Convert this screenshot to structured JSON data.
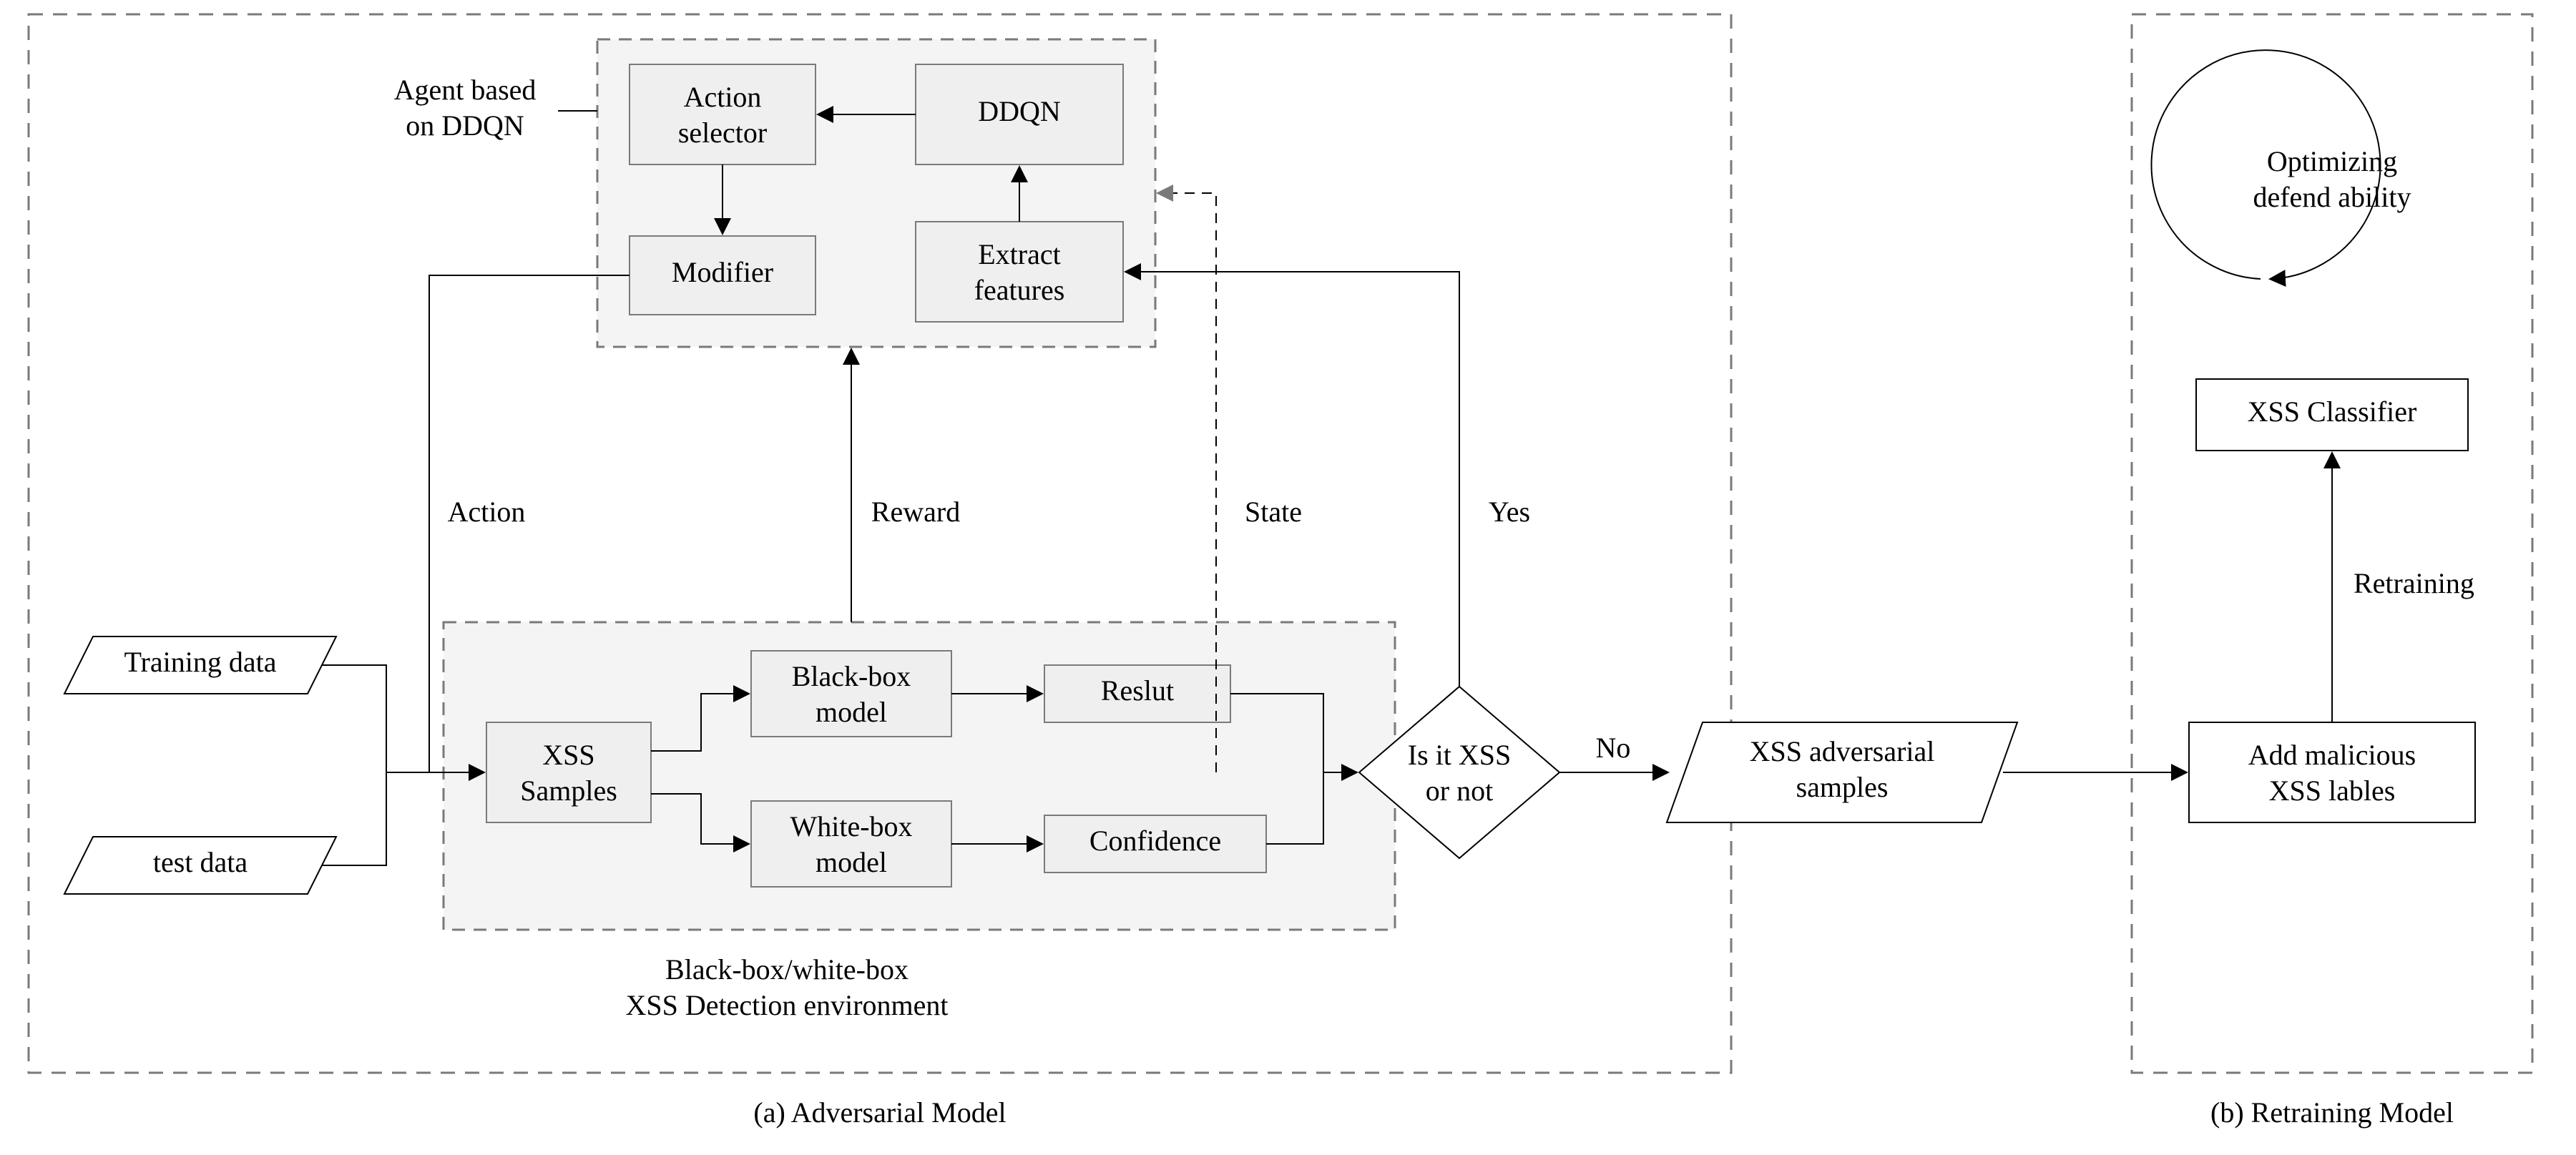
{
  "panel_a": {
    "caption": "(a) Adversarial Model",
    "agent": {
      "label_l1": "Agent based",
      "label_l2": "on DDQN",
      "action_selector_l1": "Action",
      "action_selector_l2": "selector",
      "ddqn": "DDQN",
      "modifier": "Modifier",
      "extract_l1": "Extract",
      "extract_l2": "features"
    },
    "env": {
      "label_l1": "Black-box/white-box",
      "label_l2": "XSS Detection environment",
      "xss_samples_l1": "XSS",
      "xss_samples_l2": "Samples",
      "black_l1": "Black-box",
      "black_l2": "model",
      "white_l1": "White-box",
      "white_l2": "model",
      "result": "Reslut",
      "confidence": "Confidence"
    },
    "inputs": {
      "training": "Training data",
      "test": "test data"
    },
    "edges": {
      "action": "Action",
      "reward": "Reward",
      "state": "State",
      "yes": "Yes",
      "no": "No"
    },
    "decision_l1": "Is it XSS",
    "decision_l2": "or not",
    "adv_samples_l1": "XSS adversarial",
    "adv_samples_l2": "samples"
  },
  "panel_b": {
    "caption": "(b) Retraining Model",
    "optimizing_l1": "Optimizing",
    "optimizing_l2": "defend ability",
    "classifier": "XSS Classifier",
    "retraining": "Retraining",
    "add_l1": "Add malicious",
    "add_l2": "XSS lables"
  }
}
